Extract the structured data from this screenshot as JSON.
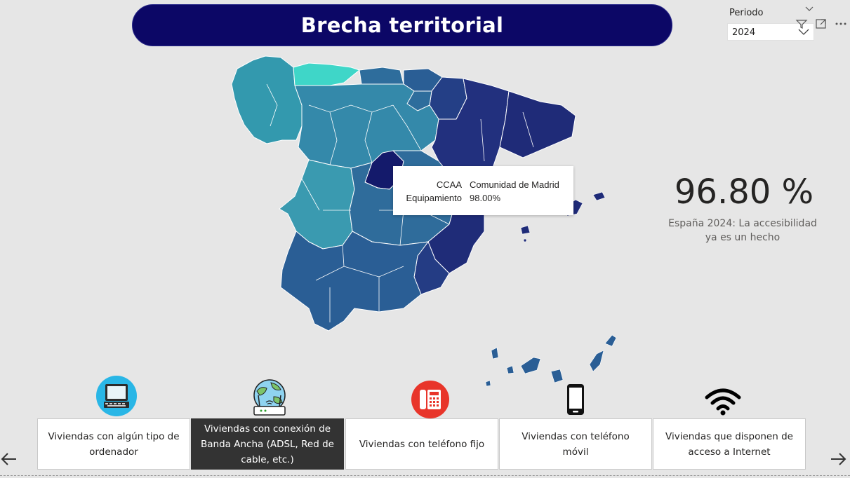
{
  "title": "Brecha territorial",
  "slicer": {
    "label": "Periodo",
    "value": "2024"
  },
  "tooltip": {
    "key1": "CCAA",
    "value1": "Comunidad de Madrid",
    "key2": "Equipamiento",
    "value2": "98.00%"
  },
  "kpi": {
    "value": "96.80 %",
    "caption": "España 2024:  La accesibilidad ya es un hecho"
  },
  "categories": [
    {
      "label": "Viviendas con algún tipo de ordenador",
      "icon": "computer-icon",
      "active": false
    },
    {
      "label": "Viviendas con conexión de Banda Ancha (ADSL, Red de cable, etc.)",
      "icon": "router-globe-icon",
      "active": true
    },
    {
      "label": "Viviendas con teléfono fijo",
      "icon": "landline-phone-icon",
      "active": false
    },
    {
      "label": "Viviendas con teléfono móvil",
      "icon": "mobile-phone-icon",
      "active": false
    },
    {
      "label": "Viviendas que disponen de acceso a Internet",
      "icon": "wifi-icon",
      "active": false
    }
  ],
  "colors": {
    "title_bg": "#0c0766",
    "active_button": "#333333",
    "map_dark": "#1c2a7a",
    "map_mid": "#2e6d9c",
    "map_light": "#3a9ab0",
    "map_lightest": "#3fd6c8"
  }
}
